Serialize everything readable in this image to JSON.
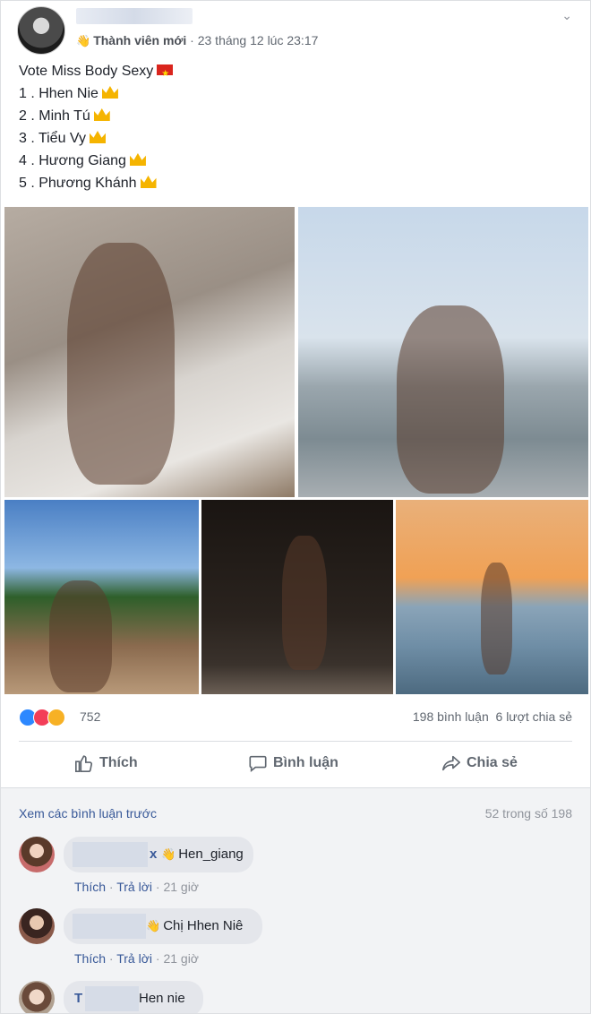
{
  "post": {
    "badge": "Thành viên mới",
    "separator": " · ",
    "timestamp": "23 tháng 12 lúc 23:17",
    "text_lines": [
      "Vote Miss Body Sexy",
      "1 . Hhen Nie",
      "2 . Minh Tú",
      "3 . Tiểu Vy",
      "4 . Hương Giang",
      "5 . Phương Khánh"
    ],
    "reaction_count": "752",
    "comments_count": "198 bình luận",
    "shares_count": "6 lượt chia sẻ"
  },
  "actions": {
    "like": "Thích",
    "comment": "Bình luận",
    "share": "Chia sẻ"
  },
  "comments_section": {
    "view_previous": "Xem các bình luận trước",
    "count_text": "52 trong số 198",
    "comments": [
      {
        "name_suffix": "x",
        "text": "Hen_giang",
        "like": "Thích",
        "reply": "Trả lời",
        "time": "21 giờ"
      },
      {
        "name_suffix": "",
        "text": "Chị Hhen Niê",
        "like": "Thích",
        "reply": "Trả lời",
        "time": "21 giờ"
      },
      {
        "name_suffix": "T",
        "text": "Hen nie"
      }
    ],
    "dot": " · "
  },
  "colors": {
    "like_blue": "#2d88ff",
    "love_red": "#f33e58",
    "wow_yellow": "#f7b125",
    "link": "#385898"
  },
  "icons": [
    "wave-icon",
    "chevron-down-icon",
    "flag-vn-icon",
    "crown-icon",
    "thumbs-up-icon",
    "comment-icon",
    "share-icon"
  ]
}
